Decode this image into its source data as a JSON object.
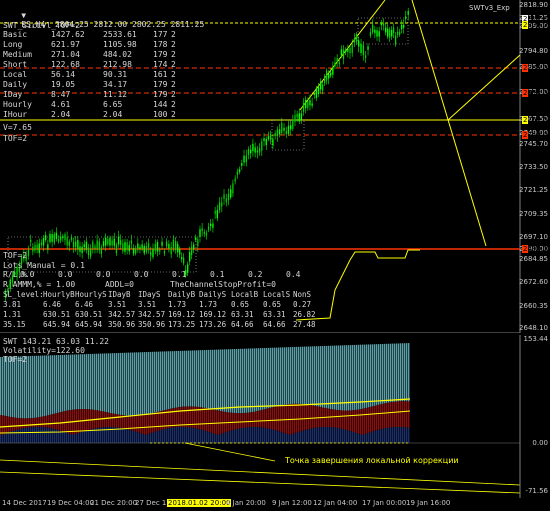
{
  "window": {
    "symbol_line": "ES,H4  2804.25 2812.00 2802.25 2811.25",
    "indicator_badge": "SWTv3_Exp"
  },
  "main_panel": {
    "label_lines": [
      "SWT_SicLvl_TOF=2",
      "V=7.65",
      "TOF=2",
      "TOF=2"
    ],
    "stat_table": [
      {
        "name": "Basic",
        "a": "1427.62",
        "b": "2533.61",
        "c": "177",
        "d": "2"
      },
      {
        "name": "Long",
        "a": "621.97",
        "b": "1105.98",
        "c": "178",
        "d": "2"
      },
      {
        "name": "Medium",
        "a": "271.04",
        "b": "484.02",
        "c": "179",
        "d": "2"
      },
      {
        "name": "Short",
        "a": "122.68",
        "b": "212.98",
        "c": "174",
        "d": "2"
      },
      {
        "name": "Local",
        "a": "56.14",
        "b": "90.31",
        "c": "161",
        "d": "2"
      },
      {
        "name": "Daily",
        "a": "19.05",
        "b": "34.17",
        "c": "179",
        "d": "2"
      },
      {
        "name": "IDay",
        "a": "8.47",
        "b": "11.12",
        "c": "179",
        "d": "2"
      },
      {
        "name": "Hourly",
        "a": "4.61",
        "b": "6.65",
        "c": "144",
        "d": "2"
      },
      {
        "name": "IHour",
        "a": "2.04",
        "b": "2.04",
        "c": "100",
        "d": "2"
      }
    ],
    "lots_line": "Lots_Manual = 0.1",
    "rl_line": "R/L,%",
    "rl_values": [
      "0.0",
      "0.0",
      "0.0",
      "0.0",
      "0.1",
      "0.1",
      "0.2",
      "0.4"
    ],
    "mm_line": "R_AMMM,% = 1.00",
    "addl_line": "ADDL=0",
    "stop_line": "TheChannelStopProfit=0",
    "level_header": [
      "SL_level:",
      "HourlyB",
      "HourlyS",
      "IDayB",
      "IDayS",
      "DailyB",
      "DailyS",
      "LocalB",
      "LocalS",
      "NonS"
    ],
    "level_rows": [
      [
        "3.81",
        "6.46",
        "6.46",
        "3.51",
        "3.51",
        "1.73",
        "1.73",
        "0.65",
        "0.65",
        "0.27"
      ],
      [
        "1.31",
        "630.51",
        "630.51",
        "342.57",
        "342.57",
        "169.12",
        "169.12",
        "63.31",
        "63.31",
        "26.82"
      ],
      [
        "35.15",
        "645.94",
        "645.94",
        "350.96",
        "350.96",
        "173.25",
        "173.26",
        "64.66",
        "64.66",
        "27.48"
      ]
    ],
    "price_axis": [
      "2818.90",
      "2811.25",
      "2809.00",
      "2794.80",
      "2785.00",
      "2772.00",
      "2767.50",
      "2749.00",
      "2745.70",
      "2733.50",
      "2721.25",
      "2709.35",
      "2697.10",
      "2690.00",
      "2684.85",
      "2672.60",
      "2660.35",
      "2648.10"
    ],
    "price_tags": [
      {
        "label": "2811.25",
        "bg": "#ffffff",
        "fg": "#000000"
      },
      {
        "label": "2809.00",
        "bg": "#ffff00",
        "fg": "#000000"
      },
      {
        "label": "2785.00",
        "bg": "#ff3300",
        "fg": "#000000"
      },
      {
        "label": "2772.00",
        "bg": "#ff3300",
        "fg": "#000000"
      },
      {
        "label": "2767.50",
        "bg": "#ffff00",
        "fg": "#000000"
      },
      {
        "label": "2749.00",
        "bg": "#ff3300",
        "fg": "#000000"
      },
      {
        "label": "2690.00",
        "bg": "#ff3300",
        "fg": "#000000"
      }
    ]
  },
  "sub_panel": {
    "label_lines": [
      "SWT 143.21 63.03 11.22",
      "Volatility=122.60",
      "TOF=2"
    ],
    "axis": [
      "153.44",
      "0.00",
      "-71.56"
    ],
    "annotation": "Точка завершения локальной коррекции"
  },
  "time_axis": [
    {
      "label": "14 Dec 2017",
      "highlight": false
    },
    {
      "label": "19 Dec 04:00",
      "highlight": false
    },
    {
      "label": "21 Dec 20:00",
      "highlight": false
    },
    {
      "label": "27 Dec 12:00",
      "highlight": false
    },
    {
      "label": "2018.01.02 20:00",
      "highlight": true
    },
    {
      "label": "4 Jan 20:00",
      "highlight": false
    },
    {
      "label": "9 Jan 12:00",
      "highlight": false
    },
    {
      "label": "12 Jan 04:00",
      "highlight": false
    },
    {
      "label": "17 Jan 00:00",
      "highlight": false
    },
    {
      "label": "19 Jan 16:00",
      "highlight": false
    }
  ],
  "colors": {
    "bull": "#00ff00",
    "bear": "#009900",
    "level_red": "#ff3300",
    "level_yellow": "#ffff00",
    "teal": "#5aa0a8",
    "dark_red": "#8a1010",
    "navy": "#1a2e6a"
  }
}
